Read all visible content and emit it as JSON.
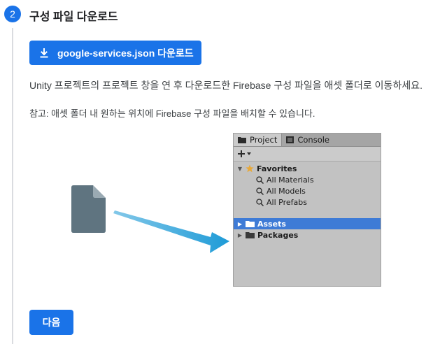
{
  "step": {
    "number": "2",
    "title": "구성 파일 다운로드"
  },
  "download_button": {
    "label": "google-services.json 다운로드",
    "icon": "download-icon"
  },
  "description": "Unity 프로젝트의 프로젝트 창을 연 후 다운로드한 Firebase 구성 파일을 애셋 폴더로 이동하세요.",
  "note": "참고: 애셋 폴더 내 원하는 위치에 Firebase 구성 파일을 배치할 수 있습니다.",
  "unity_panel": {
    "tabs": [
      {
        "label": "Project",
        "icon": "folder-icon"
      },
      {
        "label": "Console",
        "icon": "console-icon"
      }
    ],
    "add_icon": "plus-dropdown-icon",
    "favorites": {
      "label": "Favorites",
      "items": [
        "All Materials",
        "All Models",
        "All Prefabs"
      ]
    },
    "folders": [
      {
        "label": "Assets",
        "selected": true
      },
      {
        "label": "Packages",
        "selected": false
      }
    ]
  },
  "next_button": {
    "label": "다음"
  },
  "colors": {
    "primary": "#1a73e8",
    "selection": "#3e7bd6",
    "arrow": "#1e9bd7",
    "file": "#5f7480"
  }
}
